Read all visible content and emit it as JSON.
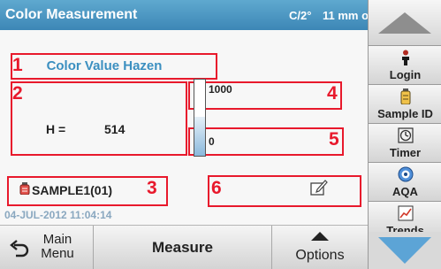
{
  "header": {
    "title": "Color Measurement",
    "mode": "C/2°",
    "cell": "11 mm o"
  },
  "measurement": {
    "parameter": "Color Value Hazen",
    "label": "H =",
    "value": "514",
    "scale_max": "1000",
    "scale_min": "0",
    "bar_level": 0.514,
    "sample_id": "SAMPLE1(01)",
    "datetime": "04-JUL-2012 11:04:14"
  },
  "callouts": [
    "1",
    "2",
    "3",
    "4",
    "5",
    "6"
  ],
  "bottom": {
    "main_menu": "Main Menu",
    "measure": "Measure",
    "options": "Options"
  },
  "sidebar": {
    "items": [
      {
        "label": "Login",
        "icon": "person-icon"
      },
      {
        "label": "Sample ID",
        "icon": "bottle-icon"
      },
      {
        "label": "Timer",
        "icon": "timer-icon"
      },
      {
        "label": "AQA",
        "icon": "aqa-icon"
      },
      {
        "label": "Trends",
        "icon": "trends-icon"
      }
    ]
  },
  "colors": {
    "accent": "#3d87b6",
    "callout": "#e8192c",
    "scroll_arrow": "#5ca4d6"
  }
}
